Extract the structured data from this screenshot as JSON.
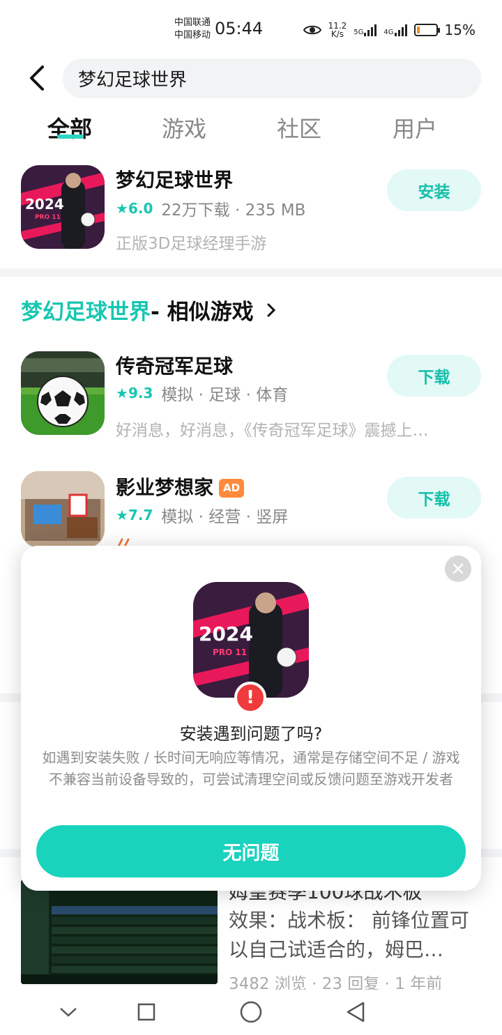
{
  "status_bar": {
    "carrier_1": "中国联通",
    "carrier_2": "中国移动",
    "time": "05:44",
    "speed_value": "11.2",
    "speed_unit": "K/s",
    "signal_1_label": "5G",
    "signal_2_label": "4G",
    "battery_percent": "15%",
    "battery_level": 0.15,
    "battery_color": "#f08a1f"
  },
  "search": {
    "query": "梦幻足球世界"
  },
  "tabs": [
    {
      "label": "全部",
      "active": true
    },
    {
      "label": "游戏",
      "active": false
    },
    {
      "label": "社区",
      "active": false
    },
    {
      "label": "用户",
      "active": false
    }
  ],
  "top_result": {
    "title": "梦幻足球世界",
    "rating": "6.0",
    "meta": "22万下载 · 235 MB",
    "description": "正版3D足球经理手游",
    "button_label": "安装",
    "icon_text": "2024",
    "icon_subtext": "PRO 11"
  },
  "similar_section": {
    "title_accent": "梦幻足球世界",
    "title_rest": " - 相似游戏"
  },
  "similar_games": [
    {
      "title": "传奇冠军足球",
      "rating": "9.3",
      "tags": "模拟 · 足球 · 体育",
      "description": "好消息，好消息，《传奇冠军足球》震撼上…",
      "button_label": "下载",
      "ad": ""
    },
    {
      "title": "影业梦想家",
      "rating": "7.7",
      "tags": "模拟 · 经营 · 竖屏",
      "description": "",
      "button_label": "下载",
      "ad": "AD"
    }
  ],
  "post": {
    "title": "姆皇赛季100球战术板",
    "body": "效果：战术板： 前锋位置可以自己试适合的，姆巴…",
    "stats": "3482 浏览 · 23 回复 · 1 年前"
  },
  "dialog": {
    "heading": "安装遇到问题了吗?",
    "body": "如遇到安装失败 / 长时间无响应等情况，通常是存储空间不足 / 游戏不兼容当前设备导致的，可尝试清理空间或反馈问题至游戏开发者",
    "confirm_label": "无问题",
    "icon_text": "2024",
    "icon_subtext": "PRO 11",
    "warn_mark": "!"
  },
  "colors": {
    "accent": "#18c6b0",
    "button_bg": "#19d3bd",
    "pill_bg": "#e3f9f6",
    "ad_badge": "#ff8a3d",
    "warn": "#ef3b3b"
  }
}
